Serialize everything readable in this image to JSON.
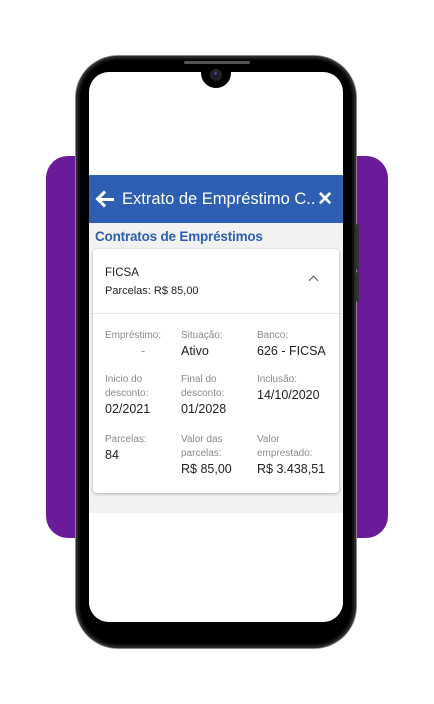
{
  "app": {
    "title": "Extrato de Empréstimo C...",
    "section_title": "Contratos de Empréstimos"
  },
  "contract": {
    "bank": "FICSA",
    "installments": "Parcelas: R$ 85,00"
  },
  "details": {
    "emprestimo": {
      "label": "Empréstimo:",
      "value": "-"
    },
    "situacao": {
      "label": "Situação:",
      "value": "Ativo"
    },
    "banco": {
      "label": "Banco:",
      "value": "626 - FICSA"
    },
    "inicio": {
      "label": "Inicio do desconto:",
      "value": "02/2021"
    },
    "final": {
      "label": "Final do desconto:",
      "value": "01/2028"
    },
    "inclusao": {
      "label": "Inclusão:",
      "value": "14/10/2020"
    },
    "parcelas": {
      "label": "Parcelas:",
      "value": "84"
    },
    "valor_parcelas": {
      "label": "Valor das parcelas:",
      "value": "R$ 85,00"
    },
    "valor_emprestado": {
      "label": "Valor emprestado:",
      "value": "R$ 3.438,51"
    }
  },
  "colors": {
    "appbar": "#2f5fb3",
    "accent_text": "#2f5fb3",
    "background_shape": "#6a1b9a"
  },
  "icons": [
    "back-arrow-icon",
    "close-icon",
    "chevron-up-icon"
  ]
}
